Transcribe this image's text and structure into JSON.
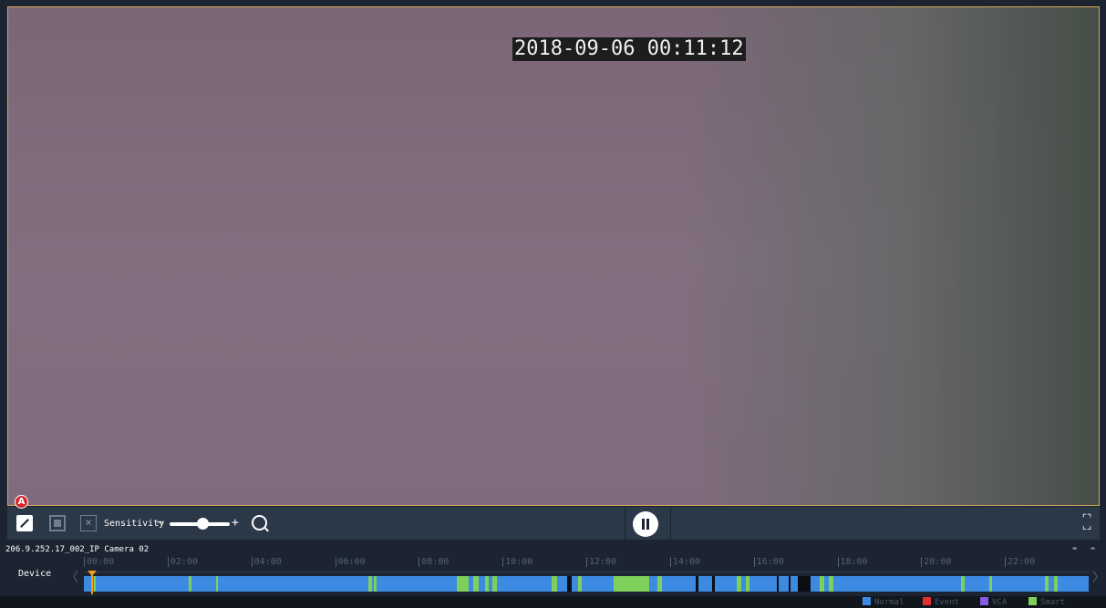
{
  "video": {
    "timestamp": "2018-09-06 00:11:12"
  },
  "annotation": {
    "marker_label": "A"
  },
  "toolbar": {
    "sensitivity_label": "Sensitivity",
    "minus": "−",
    "plus": "+",
    "sensitivity_value": 0.55
  },
  "timeline": {
    "camera_name": "206.9.252.17_002_IP Camera 02",
    "row_label": "Device",
    "ticks": [
      "|00:00",
      "|02:00",
      "|04:00",
      "|06:00",
      "|08:00",
      "|10:00",
      "|12:00",
      "|14:00",
      "|16:00",
      "|18:00",
      "|20:00",
      "|22:00"
    ],
    "range_hours": [
      0,
      24
    ],
    "cursor_time": "00:11:12",
    "segments": [
      {
        "type": "smart",
        "start": 0.23,
        "end": 0.29
      },
      {
        "type": "smart",
        "start": 2.5,
        "end": 2.56
      },
      {
        "type": "smart",
        "start": 3.15,
        "end": 3.2
      },
      {
        "type": "smart",
        "start": 6.8,
        "end": 6.88
      },
      {
        "type": "smart",
        "start": 6.92,
        "end": 7.0
      },
      {
        "type": "smart",
        "start": 8.9,
        "end": 9.2
      },
      {
        "type": "smart",
        "start": 9.3,
        "end": 9.42
      },
      {
        "type": "smart",
        "start": 9.58,
        "end": 9.68
      },
      {
        "type": "smart",
        "start": 9.75,
        "end": 9.86
      },
      {
        "type": "smart",
        "start": 11.18,
        "end": 11.3
      },
      {
        "type": "empty",
        "start": 11.55,
        "end": 11.65
      },
      {
        "type": "smart",
        "start": 11.8,
        "end": 11.9
      },
      {
        "type": "smart",
        "start": 12.65,
        "end": 13.5
      },
      {
        "type": "smart",
        "start": 13.7,
        "end": 13.8
      },
      {
        "type": "empty",
        "start": 14.62,
        "end": 14.68
      },
      {
        "type": "empty",
        "start": 15.0,
        "end": 15.06
      },
      {
        "type": "smart",
        "start": 15.6,
        "end": 15.7
      },
      {
        "type": "smart",
        "start": 15.82,
        "end": 15.9
      },
      {
        "type": "empty",
        "start": 16.55,
        "end": 16.6
      },
      {
        "type": "empty",
        "start": 16.83,
        "end": 16.88
      },
      {
        "type": "empty",
        "start": 17.05,
        "end": 17.35
      },
      {
        "type": "smart",
        "start": 17.58,
        "end": 17.68
      },
      {
        "type": "smart",
        "start": 17.8,
        "end": 17.9
      },
      {
        "type": "smart",
        "start": 20.95,
        "end": 21.03
      },
      {
        "type": "smart",
        "start": 21.62,
        "end": 21.7
      },
      {
        "type": "smart",
        "start": 22.95,
        "end": 23.05
      },
      {
        "type": "smart",
        "start": 23.17,
        "end": 23.26
      }
    ]
  },
  "legend": [
    {
      "label": "Normal",
      "color": "#3d8ae2"
    },
    {
      "label": "Event",
      "color": "#e03030"
    },
    {
      "label": "VCA",
      "color": "#8a5ce6"
    },
    {
      "label": "Smart",
      "color": "#7fd05a"
    }
  ],
  "colors": {
    "normal": "#3d8ae2",
    "smart": "#7fd05a",
    "empty": "#0b0f14",
    "cursor": "#f29b1d",
    "active_border": "#d6a85a"
  },
  "icons": [
    "draw-area-icon",
    "select-region-icon",
    "clear-region-icon",
    "search-icon",
    "pause-icon",
    "fullscreen-icon",
    "zoom-out-icon",
    "zoom-in-icon",
    "chevron-left-icon",
    "chevron-right-icon"
  ]
}
